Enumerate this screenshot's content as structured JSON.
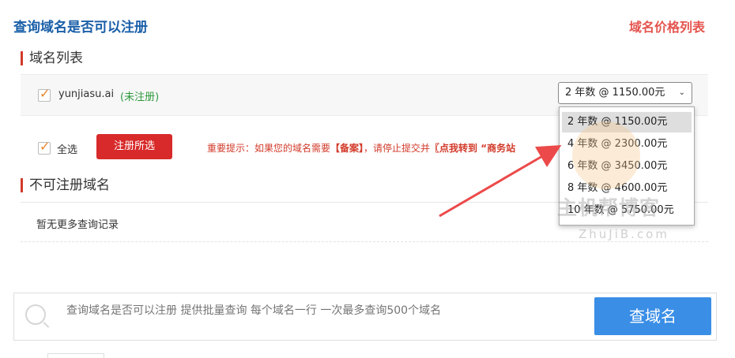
{
  "header": {
    "title": "查询域名是否可以注册",
    "price_link": "域名价格列表"
  },
  "domain_list": {
    "heading": "域名列表",
    "items": [
      {
        "domain": "yunjiasu.ai",
        "status": "(未注册)",
        "checked": true,
        "selected_option": "2 年数 @ 1150.00元"
      }
    ],
    "select_all_label": "全选",
    "register_button": "注册所选",
    "notice": {
      "prefix": "重要提示：如果您的域名需要",
      "bracket": "【备案】",
      "mid": "，请停止提交并",
      "link": "〖点我转到 “商务站"
    }
  },
  "unavailable": {
    "heading": "不可注册域名",
    "empty_text": "暂无更多查询记录"
  },
  "search": {
    "placeholder": "查询域名是否可以注册 提供批量查询 每个域名一行 一次最多查询500个域名",
    "button": "查域名"
  },
  "dropdown": {
    "options": [
      "2 年数 @ 1150.00元",
      "4 年数 @ 2300.00元",
      "6 年数 @ 3450.00元",
      "8 年数 @ 4600.00元",
      "10 年数 @ 5750.00元"
    ],
    "selected_index": 0
  },
  "watermark": {
    "text": "主机帮博客",
    "url": "ZhuJiB.com"
  },
  "colors": {
    "title_blue": "#1a5fa8",
    "accent_red": "#d82a2a",
    "status_green": "#2e9a3c",
    "button_blue": "#3a8ee6"
  }
}
